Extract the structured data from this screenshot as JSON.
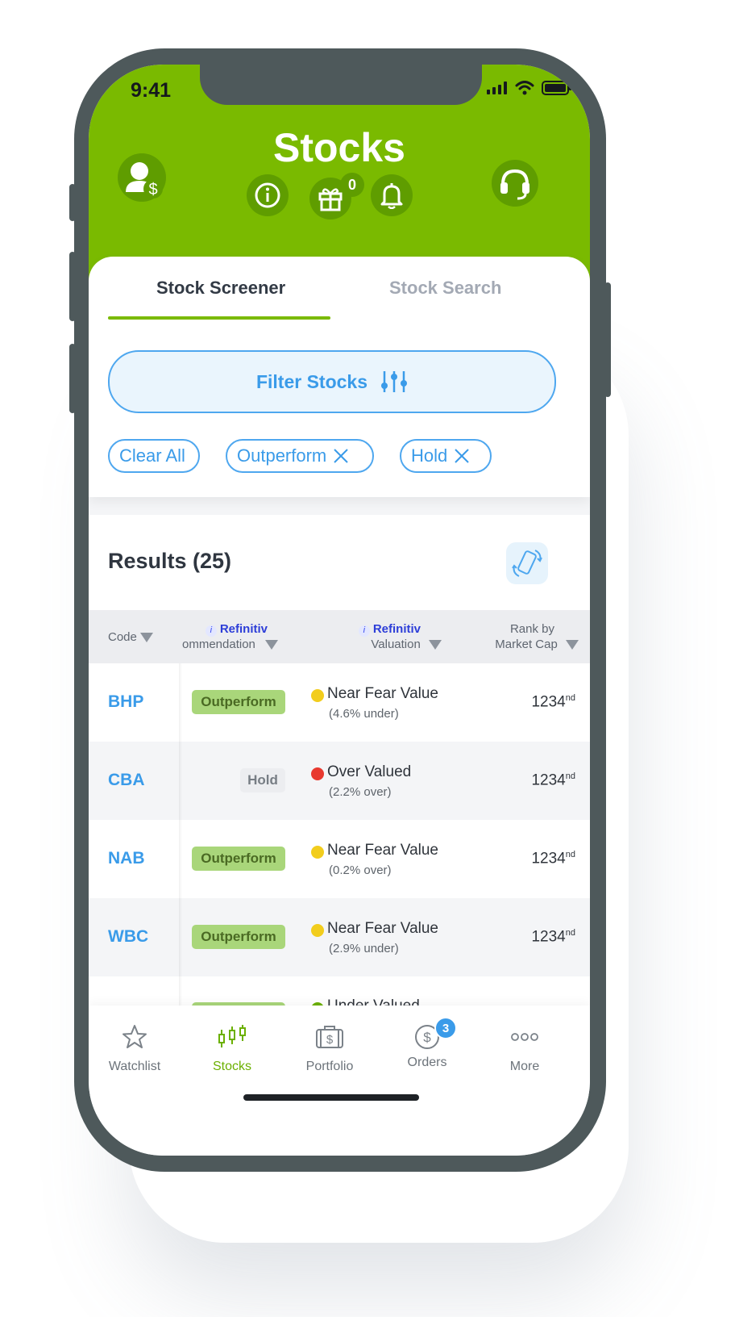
{
  "status_bar": {
    "time": "9:41"
  },
  "header": {
    "title": "Stocks",
    "gift_count": "0"
  },
  "tabs": [
    {
      "label": "Stock Screener",
      "active": true
    },
    {
      "label": "Stock Search",
      "active": false
    }
  ],
  "filter": {
    "button_label": "Filter Stocks",
    "chips": [
      "Clear All",
      "Outperform",
      "Hold"
    ]
  },
  "results": {
    "title": "Results (25)"
  },
  "table": {
    "columns": {
      "code": "Code",
      "rec_source": "Refinitiv",
      "rec_label": "ommendation",
      "val_source": "Refinitiv",
      "val_label": "Valuation",
      "rank_line1": "Rank by",
      "rank_line2": "Market Cap"
    },
    "rows": [
      {
        "code": "BHP",
        "rec": "Outperform",
        "val": "Near Fear Value",
        "val_sub": "(4.6% under)",
        "rank": "1234",
        "rank_suffix": "nd",
        "dot": "#f2cd1d"
      },
      {
        "code": "CBA",
        "rec": "Hold",
        "val": "Over Valued",
        "val_sub": "(2.2% over)",
        "rank": "1234",
        "rank_suffix": "nd",
        "dot": "#e8392f"
      },
      {
        "code": "NAB",
        "rec": "Outperform",
        "val": "Near Fear Value",
        "val_sub": "(0.2% over)",
        "rank": "1234",
        "rank_suffix": "nd",
        "dot": "#f2cd1d"
      },
      {
        "code": "WBC",
        "rec": "Outperform",
        "val": "Near Fear Value",
        "val_sub": "(2.9% under)",
        "rank": "1234",
        "rank_suffix": "nd",
        "dot": "#f2cd1d"
      },
      {
        "code": "",
        "rec": "",
        "val": "Under Valued",
        "val_sub": "",
        "rank": "",
        "rank_suffix": "",
        "dot": "#6bb000"
      }
    ]
  },
  "bottom_nav": {
    "items": [
      {
        "label": "Watchlist",
        "icon": "star-icon"
      },
      {
        "label": "Stocks",
        "icon": "candlestick-icon",
        "active": true
      },
      {
        "label": "Portfolio",
        "icon": "briefcase-icon"
      },
      {
        "label": "Orders",
        "icon": "dollar-circle-icon",
        "badge": "3"
      },
      {
        "label": "More",
        "icon": "more-dots-icon"
      }
    ]
  },
  "colors": {
    "brand_green": "#7aba00",
    "accent_blue": "#3a9be9",
    "phone_frame": "#4e595b"
  }
}
